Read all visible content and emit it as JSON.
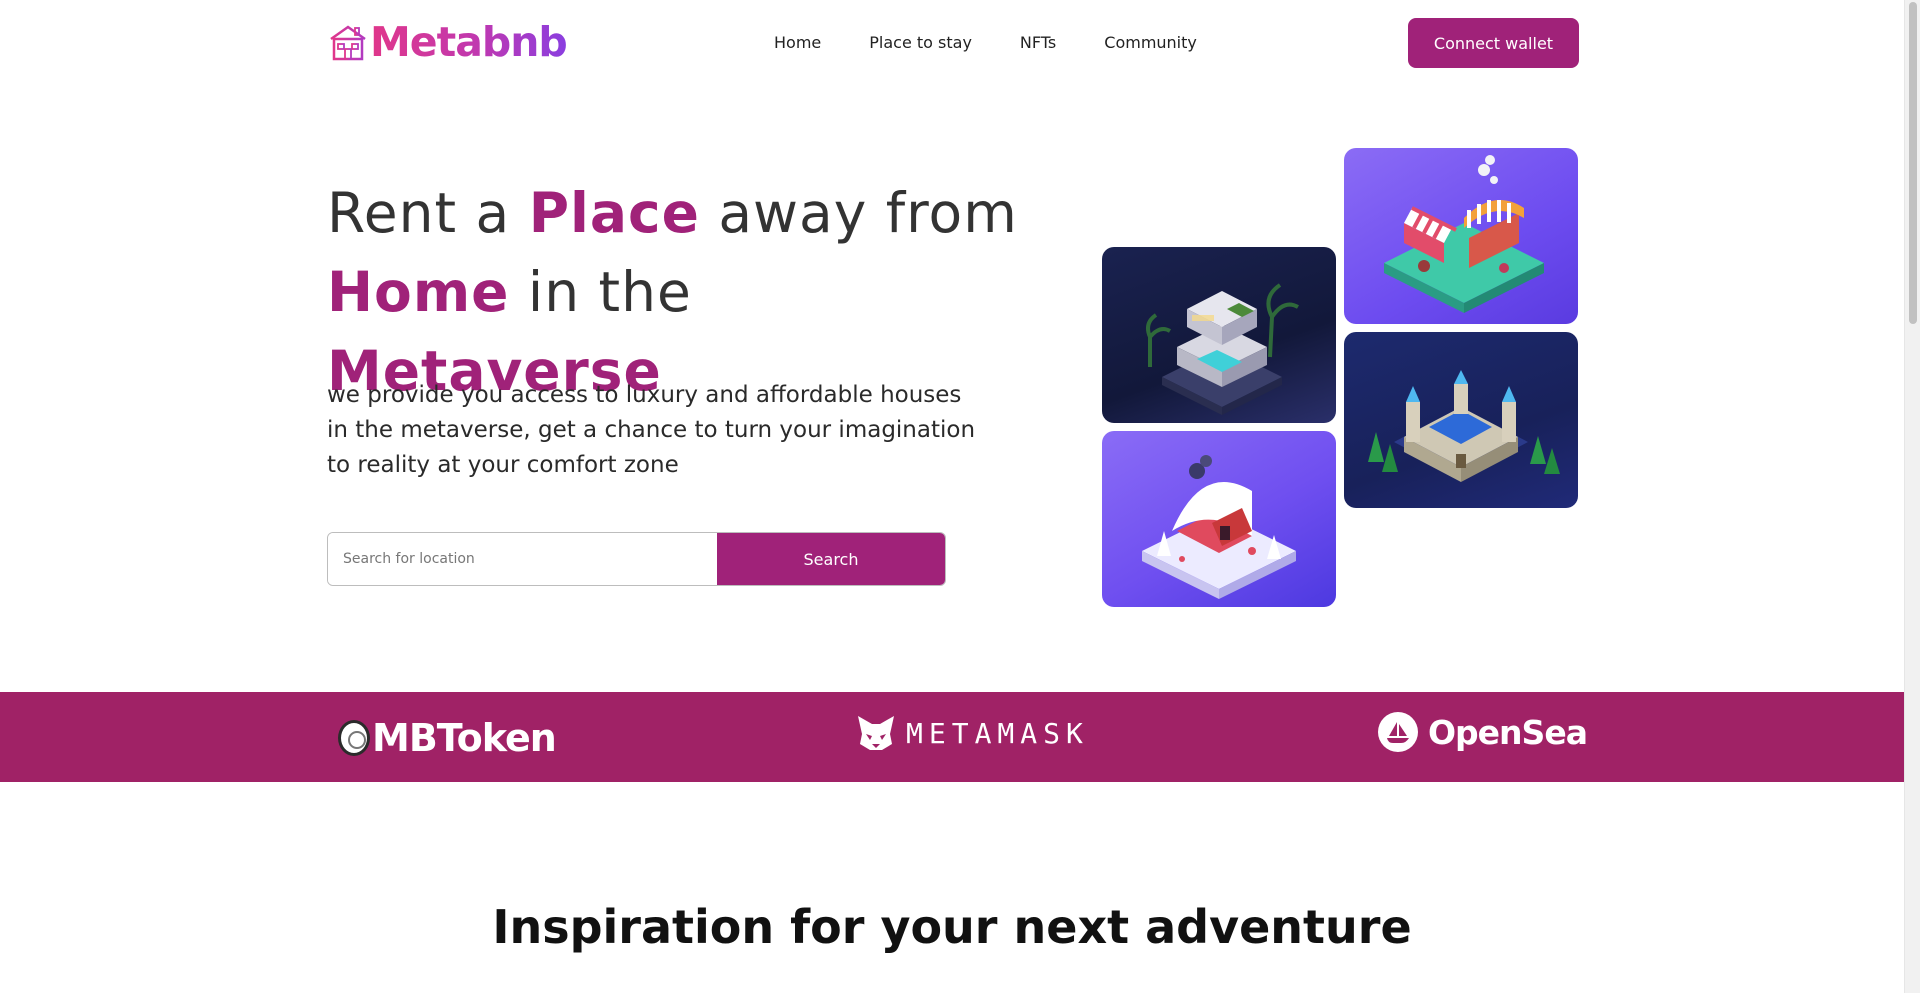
{
  "brand": {
    "name": "Metabnb",
    "logo_icon": "house-icon"
  },
  "nav": {
    "items": [
      {
        "label": "Home"
      },
      {
        "label": "Place to stay"
      },
      {
        "label": "NFTs"
      },
      {
        "label": "Community"
      }
    ]
  },
  "header": {
    "connect_label": "Connect wallet"
  },
  "hero": {
    "title": {
      "w1": "Rent a ",
      "w2": "Place",
      "w3": " away from",
      "w4": "Home",
      "w5": " in the ",
      "w6": "Metaverse"
    },
    "description": "we provide you access to luxury and affordable houses in the metaverse, get a chance to turn your imagination to reality at your comfort zone",
    "search": {
      "placeholder": "Search for location",
      "button_label": "Search"
    }
  },
  "gallery": [
    {
      "name": "villa-image",
      "icon": "villa-illustration"
    },
    {
      "name": "market-image",
      "icon": "market-illustration"
    },
    {
      "name": "castle-image",
      "icon": "castle-illustration"
    },
    {
      "name": "snow-house-image",
      "icon": "snow-house-illustration"
    }
  ],
  "partners": [
    {
      "name": "MBToken",
      "icon": "coin-icon"
    },
    {
      "name": "METAMASK",
      "icon": "fox-icon"
    },
    {
      "name": "OpenSea",
      "icon": "ship-icon"
    }
  ],
  "colors": {
    "accent": "#a02279",
    "band": "#a02266",
    "logo_gradient": [
      "#e0378a",
      "#8a3ee0"
    ]
  },
  "section": {
    "title": "Inspiration for your next adventure"
  }
}
